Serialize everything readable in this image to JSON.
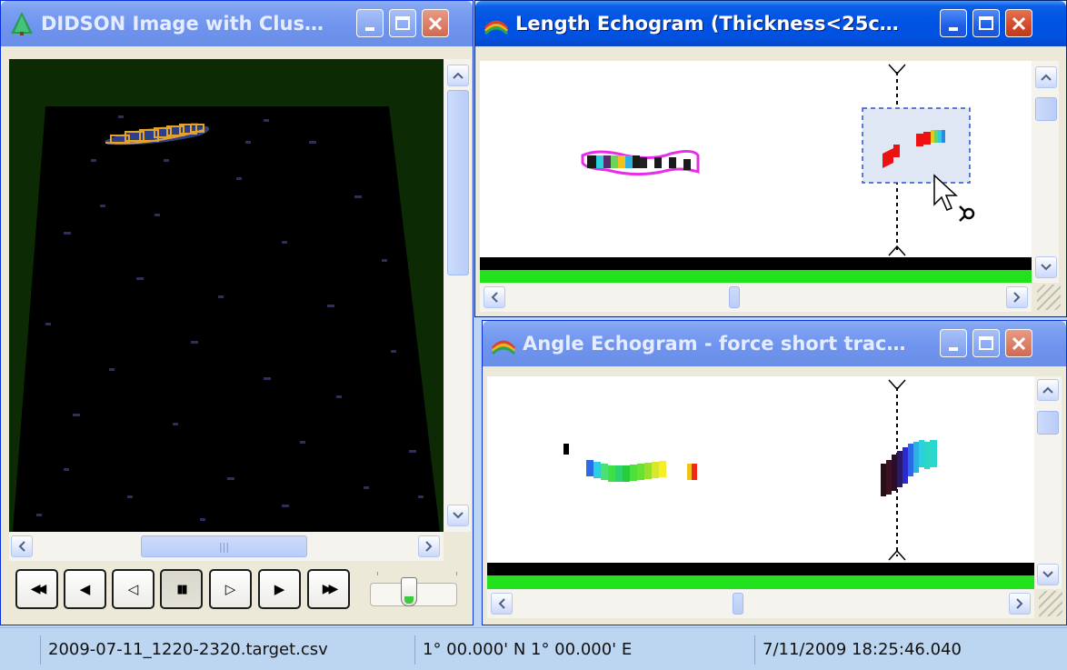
{
  "windows": {
    "didson": {
      "title": "DIDSON Image with Clus…",
      "scroll_h_grip": "|||"
    },
    "length": {
      "title": "Length Echogram (Thickness<25c…"
    },
    "angle": {
      "title": "Angle Echogram - force short trac…"
    }
  },
  "playback": {
    "buttons": [
      {
        "name": "rewind-button",
        "glyph": "◀◀"
      },
      {
        "name": "step-back-button",
        "glyph": "◀"
      },
      {
        "name": "play-reverse-button",
        "glyph": "◁"
      },
      {
        "name": "pause-button",
        "glyph": "▮▮"
      },
      {
        "name": "play-forward-button",
        "glyph": "▷"
      },
      {
        "name": "step-forward-button",
        "glyph": "▶"
      },
      {
        "name": "fast-forward-button",
        "glyph": "▶▶"
      }
    ]
  },
  "status": {
    "file": "2009-07-11_1220-2320.target.csv",
    "coords": "1° 00.000' N 1° 00.000' E",
    "timestamp": "7/11/2009 18:25:46.040"
  },
  "colors": {
    "title_active": "#0054e3",
    "echogram_floor": "#22e21e",
    "sonar_bg": "#0c2b04",
    "track_outline": "#e62ee6",
    "selection_box": "#2a52c9"
  }
}
